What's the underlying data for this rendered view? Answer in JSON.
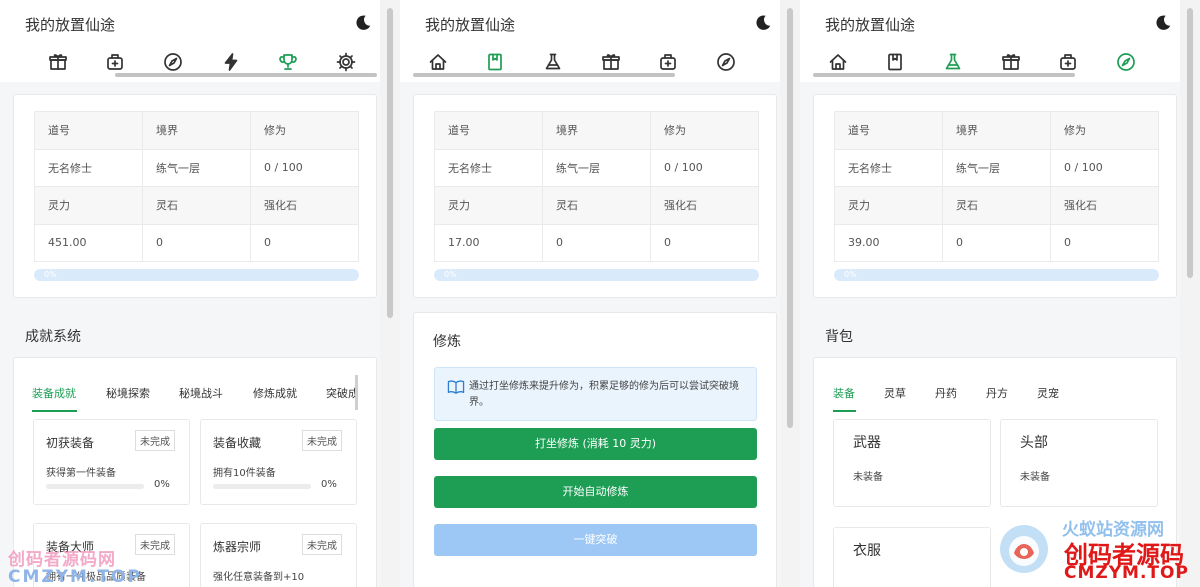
{
  "app_title": "我的放置仙途",
  "theme_icon": "moon-icon",
  "colors": {
    "accent": "#1e9e55",
    "progress": "#d9ebfb",
    "disabled_button": "#9dc7f4"
  },
  "player": {
    "headers1": [
      "道号",
      "境界",
      "修为"
    ],
    "values1": [
      "无名修士",
      "练气一层",
      "0 / 100"
    ],
    "headers2": [
      "灵力",
      "灵石",
      "强化石"
    ]
  },
  "panels": [
    {
      "nav": [
        "gift-icon",
        "bag-icon",
        "compass-icon",
        "bolt-icon",
        "trophy-icon",
        "gear-icon"
      ],
      "active_nav": "trophy-icon",
      "values2": [
        "451.00",
        "0",
        "0"
      ],
      "progress_label": "0%",
      "progress": 0
    },
    {
      "nav": [
        "home-icon",
        "book-icon",
        "flask-icon",
        "gift-icon",
        "bag-icon",
        "compass-icon"
      ],
      "active_nav": "book-icon",
      "values2": [
        "17.00",
        "0",
        "0"
      ],
      "progress_label": "0%",
      "progress": 0
    },
    {
      "nav": [
        "home-icon",
        "book-icon",
        "flask-icon",
        "gift-icon",
        "bag-icon",
        "compass-icon"
      ],
      "active_nav": "flask-icon",
      "values2": [
        "39.00",
        "0",
        "0"
      ],
      "progress_label": "0%",
      "progress": 0
    }
  ],
  "achievements": {
    "title": "成就系统",
    "tabs": [
      "装备成就",
      "秘境探索",
      "秘境战斗",
      "修炼成就",
      "突破成"
    ],
    "active_tab": 0,
    "items": [
      {
        "title": "初获装备",
        "status": "未完成",
        "desc": "获得第一件装备",
        "percent": "0%",
        "progress": 0
      },
      {
        "title": "装备收藏",
        "status": "未完成",
        "desc": "拥有10件装备",
        "percent": "0%",
        "progress": 0
      },
      {
        "title": "装备大师",
        "status": "未完成",
        "desc": "拥有一件极品品质装备",
        "percent": "",
        "progress": 0
      },
      {
        "title": "炼器宗师",
        "status": "未完成",
        "desc": "强化任意装备到+10",
        "percent": "",
        "progress": 0
      }
    ]
  },
  "training": {
    "title": "修炼",
    "hint": "通过打坐修炼来提升修为，积累足够的修为后可以尝试突破境界。",
    "meditate_button": "打坐修炼 (消耗 10 灵力)",
    "auto_button": "开始自动修炼",
    "breakthrough_button": "一键突破"
  },
  "bag": {
    "title": "背包",
    "tabs": [
      "装备",
      "灵草",
      "丹药",
      "丹方",
      "灵宠"
    ],
    "active_tab": 0,
    "slots": [
      {
        "name": "武器",
        "value": "未装备"
      },
      {
        "name": "头部",
        "value": "未装备"
      },
      {
        "name": "衣服",
        "value": ""
      }
    ]
  },
  "watermarks": {
    "left_line1": "创码者源码网",
    "left_line2": "CMZYM.TOP",
    "right_top": "火蚁站资源网",
    "right_main": "创码者源码",
    "right_url": "CMZYM.TOP"
  }
}
